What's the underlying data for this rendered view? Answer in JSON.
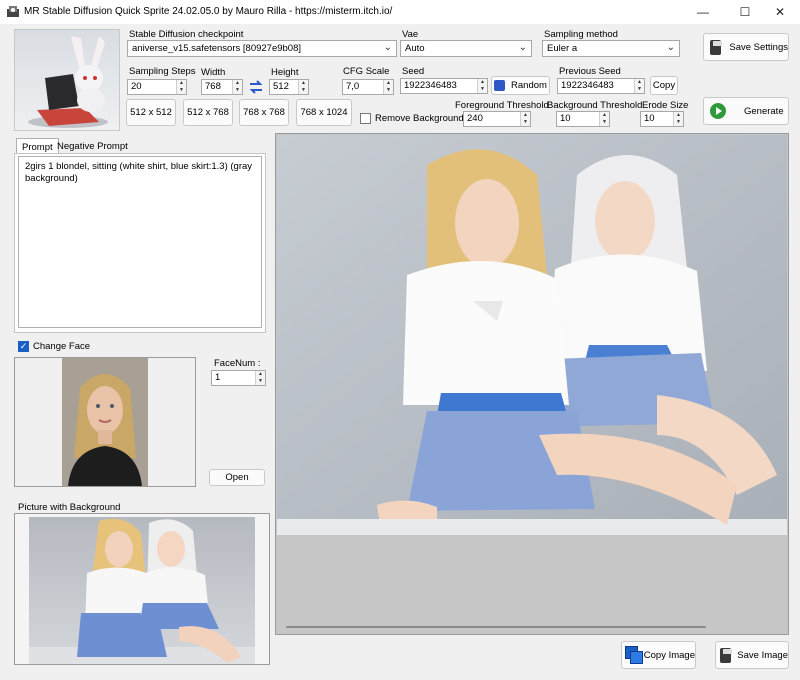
{
  "window": {
    "title": "MR Stable Diffusion Quick Sprite 24.02.05.0 by Mauro Rilla - https://misterm.itch.io/",
    "minimize": "—",
    "maximize": "☐",
    "close": "✕"
  },
  "checkpoint": {
    "label": "Stable Diffusion checkpoint",
    "value": "aniverse_v15.safetensors [80927e9b08]"
  },
  "vae": {
    "label": "Vae",
    "value": "Auto"
  },
  "sampling": {
    "label": "Sampling method",
    "value": "Euler a"
  },
  "save_settings": "Save Settings",
  "generate": "Generate",
  "steps": {
    "label": "Sampling Steps",
    "value": "20"
  },
  "width": {
    "label": "Width",
    "value": "768"
  },
  "height": {
    "label": "Height",
    "value": "512"
  },
  "cfg": {
    "label": "CFG Scale",
    "value": "7,0"
  },
  "seed": {
    "label": "Seed",
    "value": "1922346483",
    "random": "Random"
  },
  "previous_seed": {
    "label": "Previous Seed",
    "value": "1922346483",
    "copy": "Copy"
  },
  "presets": [
    "512 x 512",
    "512 x 768",
    "768 x 768",
    "768 x 1024"
  ],
  "remove_background": {
    "label": "Remove Background",
    "checked": false
  },
  "foreground_threshold": {
    "label": "Foreground Threshold",
    "value": "240"
  },
  "background_threshold": {
    "label": "Background Threshold",
    "value": "10"
  },
  "erode_size": {
    "label": "Erode Size",
    "value": "10"
  },
  "tabs": {
    "prompt": "Prompt",
    "negative": "Negative Prompt"
  },
  "prompt_text": "2girs 1 blondel, sitting (white shirt, blue skirt:1.3) (gray background)",
  "change_face": {
    "label": "Change Face",
    "checked": true
  },
  "facenum": {
    "label": "FaceNum :",
    "value": "1"
  },
  "open": "Open",
  "picture_bg_label": "Picture with Background",
  "copy_image": "Copy Image",
  "save_image": "Save Image",
  "colors": {
    "accent": "#1a5fc4",
    "generate_green": "#2f9a3a"
  }
}
